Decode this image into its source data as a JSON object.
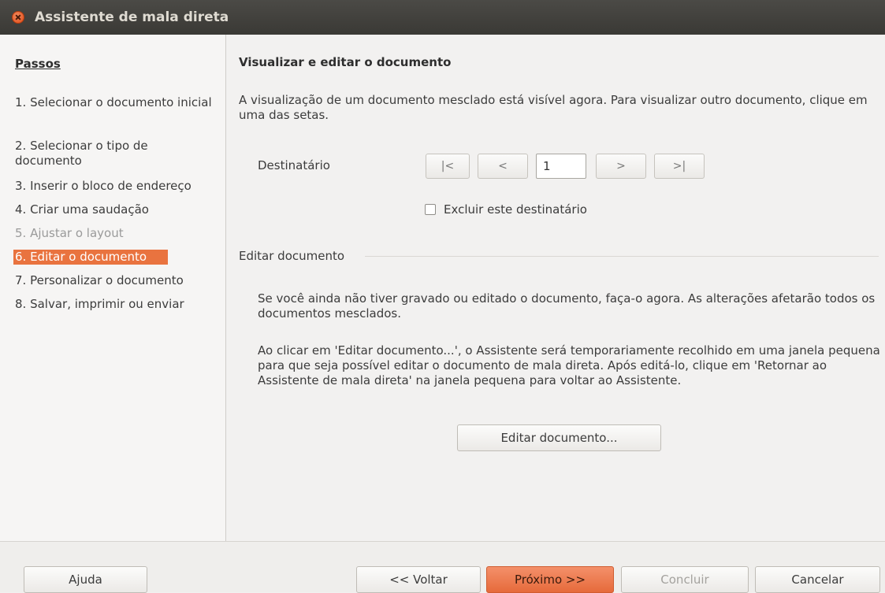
{
  "window": {
    "title": "Assistente de mala direta"
  },
  "sidebar": {
    "header": "Passos",
    "steps": [
      {
        "label": "1. Selecionar o documento inicial"
      },
      {
        "label": "2. Selecionar o tipo de documento"
      },
      {
        "label": "3. Inserir o bloco de endereço"
      },
      {
        "label": "4. Criar uma saudação"
      },
      {
        "label": "5. Ajustar o layout"
      },
      {
        "label": "6. Editar o documento"
      },
      {
        "label": "7. Personalizar o documento"
      },
      {
        "label": "8. Salvar, imprimir ou enviar"
      }
    ]
  },
  "main": {
    "title": "Visualizar e editar o documento",
    "intro": "A visualização de um documento mesclado está visível agora. Para visualizar outro documento, clique em uma das setas.",
    "recipient_label": "Destinatário",
    "nav": {
      "first": "|<",
      "prev": "<",
      "current": "1",
      "next": ">",
      "last": ">|"
    },
    "exclude_label": "Excluir este destinatário",
    "edit_section_label": "Editar documento",
    "edit_text1": "Se você ainda não tiver gravado ou editado o documento, faça-o agora. As alterações afetarão todos os documentos mesclados.",
    "edit_text2": "Ao clicar em 'Editar documento...', o Assistente será temporariamente recolhido em uma janela pequena para que seja possível editar o documento de mala direta. Após editá-lo, clique em 'Retornar ao Assistente de mala direta' na janela pequena para voltar ao Assistente.",
    "edit_button": "Editar documento..."
  },
  "footer": {
    "help": "Ajuda",
    "back": "<< Voltar",
    "next": "Próximo >>",
    "finish": "Concluir",
    "cancel": "Cancelar"
  },
  "colors": {
    "accent": "#e9733f",
    "titlebar": "#3c3b37"
  }
}
